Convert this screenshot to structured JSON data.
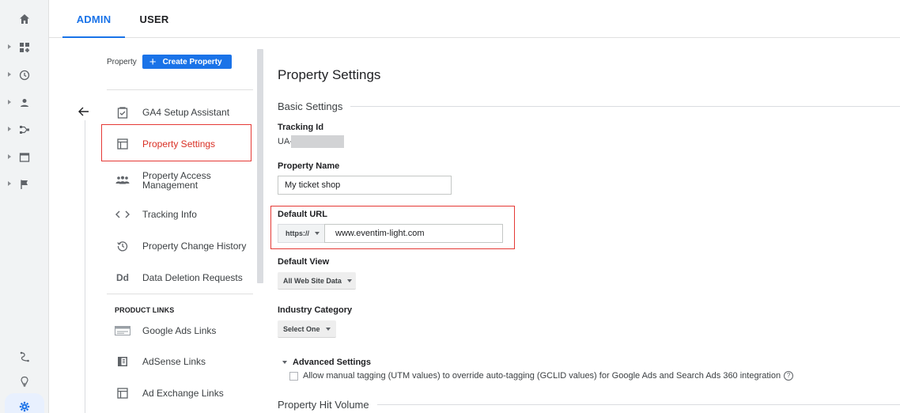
{
  "tabs": {
    "admin": "ADMIN",
    "user": "USER"
  },
  "sidebar": {
    "property_label": "Property",
    "create_property": "Create Property",
    "items": [
      {
        "label": "GA4 Setup Assistant",
        "icon": "checklist-icon"
      },
      {
        "label": "Property Settings",
        "icon": "window-icon"
      },
      {
        "label": "Property Access\nManagement",
        "icon": "people-icon"
      },
      {
        "label": "Tracking Info",
        "icon": "code-icon"
      },
      {
        "label": "Property Change History",
        "icon": "history-icon"
      },
      {
        "label": "Data Deletion Requests",
        "icon": "dd-icon"
      }
    ],
    "product_links_heading": "PRODUCT LINKS",
    "product_links": [
      {
        "label": "Google Ads Links",
        "icon": "ads-icon"
      },
      {
        "label": "AdSense Links",
        "icon": "adsense-icon"
      },
      {
        "label": "Ad Exchange Links",
        "icon": "window-icon"
      }
    ],
    "dd_glyph": "Dd"
  },
  "main": {
    "title": "Property Settings",
    "basic_settings": "Basic Settings",
    "tracking_id_label": "Tracking Id",
    "tracking_id_value": "UA-",
    "property_name_label": "Property Name",
    "property_name_value": "My ticket shop",
    "default_url_label": "Default URL",
    "protocol": "https://",
    "default_url_value": "www.eventim-light.com",
    "default_view_label": "Default View",
    "default_view_value": "All Web Site Data",
    "industry_label": "Industry Category",
    "industry_value": "Select One",
    "advanced_settings": "Advanced Settings",
    "manual_tagging_text": "Allow manual tagging (UTM values) to override auto-tagging (GCLID values) for Google Ads and Search Ads 360 integration",
    "help_glyph": "?",
    "hit_volume": "Property Hit Volume"
  },
  "colors": {
    "accent": "#1a73e8",
    "highlight": "#e53935",
    "active_text": "#d93025"
  }
}
